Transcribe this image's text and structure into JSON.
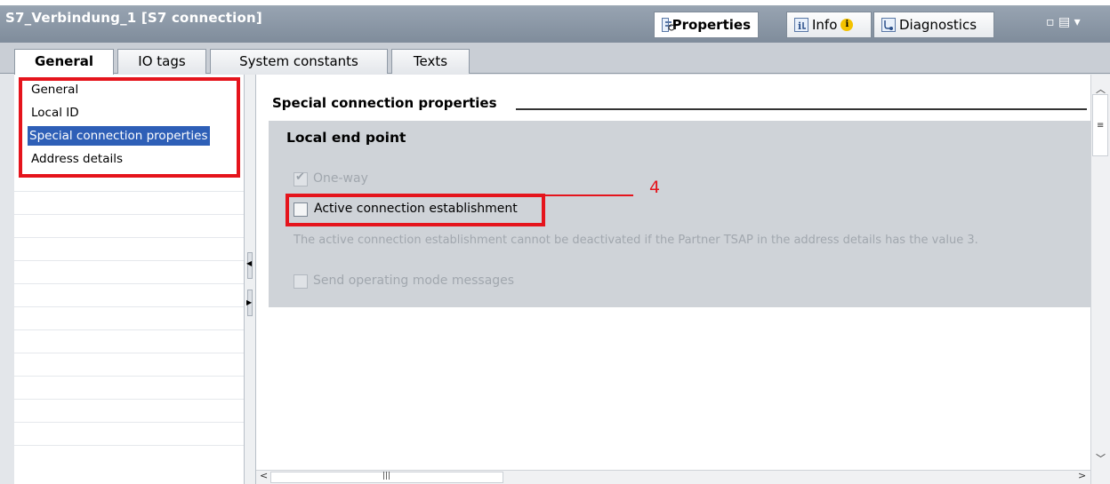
{
  "window": {
    "title": "S7_Verbindung_1 [S7 connection]",
    "right_tabs": [
      {
        "label": "Properties",
        "icon": "properties-icon",
        "active": true
      },
      {
        "label": "Info",
        "icon": "info-icon",
        "active": false
      },
      {
        "label": "Diagnostics",
        "icon": "diagnostics-icon",
        "active": false
      }
    ],
    "window_controls": "▫ ▤ ▾"
  },
  "tabs": [
    {
      "label": "General",
      "active": true
    },
    {
      "label": "IO tags",
      "active": false
    },
    {
      "label": "System constants",
      "active": false
    },
    {
      "label": "Texts",
      "active": false
    }
  ],
  "nav": {
    "items": [
      {
        "label": "General"
      },
      {
        "label": "Local ID"
      },
      {
        "label": "Special connection properties",
        "selected": true
      },
      {
        "label": "Address details"
      }
    ]
  },
  "section": {
    "title": "Special connection properties",
    "group_title": "Local end point",
    "one_way": {
      "label": "One-way",
      "checked": true,
      "enabled": false
    },
    "active_connection": {
      "label": "Active connection establishment",
      "checked": false,
      "enabled": true
    },
    "note": "The active connection establishment cannot be deactivated if the Partner TSAP in the address details has the value 3.",
    "send_mode": {
      "label": "Send operating mode messages",
      "checked": false,
      "enabled": false
    }
  },
  "annotation": {
    "number": "4"
  },
  "colors": {
    "highlight_red": "#e5141c",
    "selection_blue": "#2e5fb7",
    "titlebar": "#8b97a5"
  }
}
